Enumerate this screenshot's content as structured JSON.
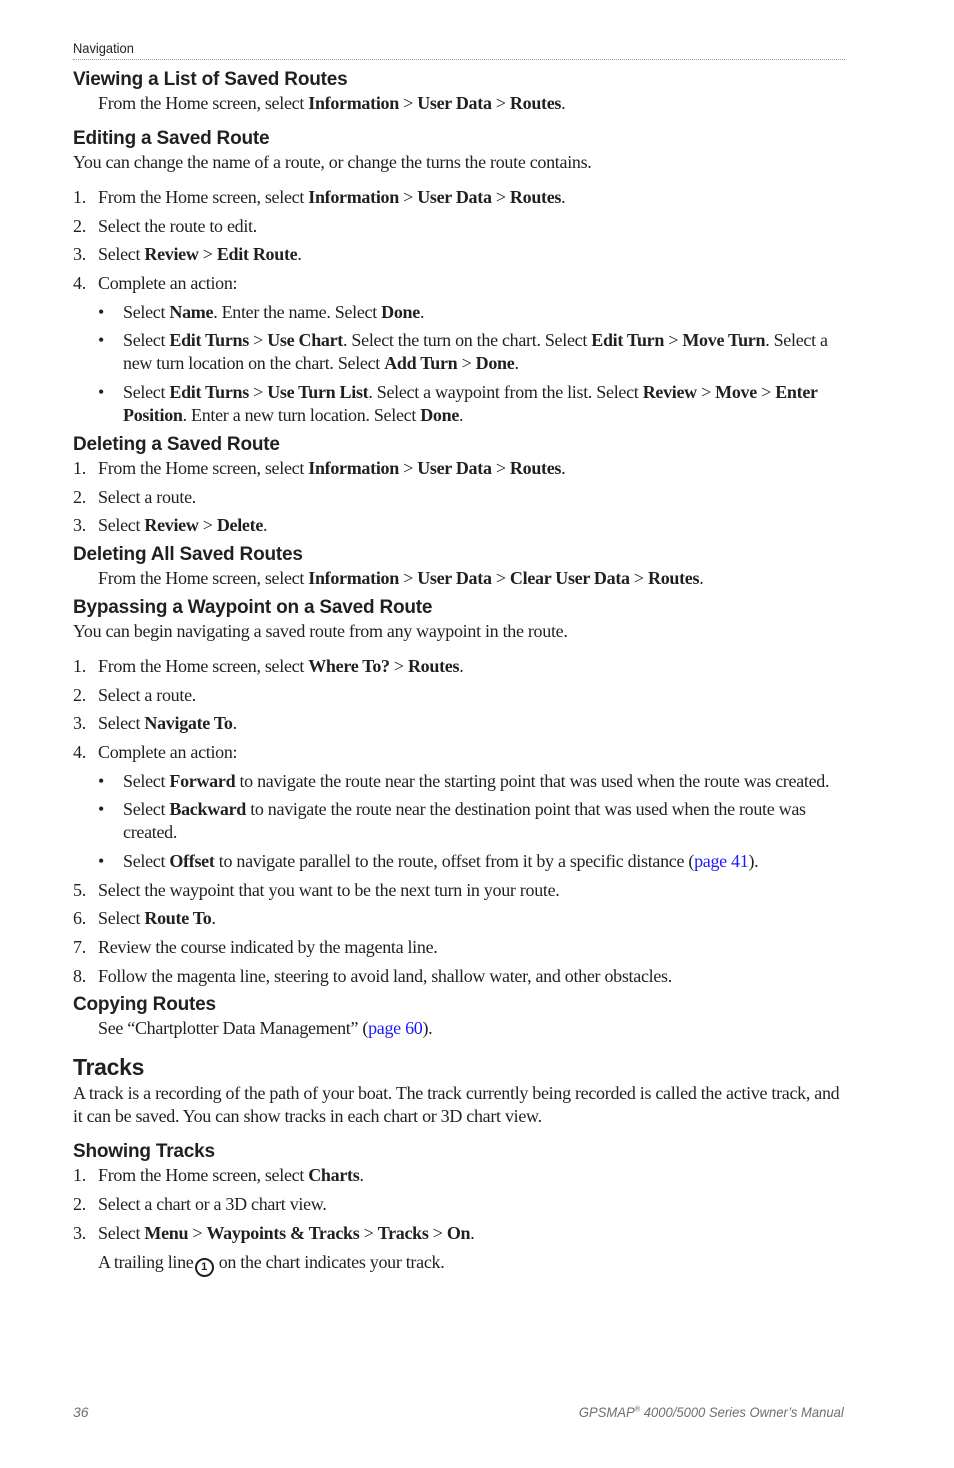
{
  "header": {
    "section": "Navigation"
  },
  "sections": {
    "viewing": {
      "title": "Viewing a List of Saved Routes",
      "text": [
        "From the Home screen, select ",
        "Information",
        " > ",
        "User Data",
        " > ",
        "Routes",
        "."
      ]
    },
    "editing": {
      "title": "Editing a Saved Route",
      "intro": "You can change the name of a route, or change the turns the route contains.",
      "steps": [
        {
          "num": "1.",
          "parts": [
            "From the Home screen, select ",
            "Information",
            " > ",
            "User Data",
            " > ",
            "Routes",
            "."
          ]
        },
        {
          "num": "2.",
          "parts": [
            "Select the route to edit."
          ]
        },
        {
          "num": "3.",
          "parts": [
            "Select ",
            "Review",
            " > ",
            "Edit Route",
            "."
          ]
        },
        {
          "num": "4.",
          "parts": [
            "Complete an action:"
          ]
        }
      ],
      "bullets": [
        {
          "parts": [
            "Select ",
            "Name",
            ". Enter the name. Select ",
            "Done",
            "."
          ]
        },
        {
          "parts": [
            "Select ",
            "Edit Turns",
            " > ",
            "Use Chart",
            ". Select the turn on the chart. Select ",
            "Edit Turn",
            " > ",
            "Move Turn",
            ". Select a new turn location on the chart. Select ",
            "Add Turn",
            " > ",
            "Done",
            "."
          ]
        },
        {
          "parts": [
            "Select ",
            "Edit Turns",
            " > ",
            "Use Turn List",
            ". Select a waypoint from the list. Select ",
            "Review",
            " > ",
            "Move",
            " > ",
            "Enter Position",
            ". Enter a new turn location. Select ",
            "Done",
            "."
          ]
        }
      ]
    },
    "deleting": {
      "title": "Deleting a Saved Route",
      "steps": [
        {
          "num": "1.",
          "parts": [
            "From the Home screen, select ",
            "Information",
            " > ",
            "User Data",
            " > ",
            "Routes",
            "."
          ]
        },
        {
          "num": "2.",
          "parts": [
            "Select a route."
          ]
        },
        {
          "num": "3.",
          "parts": [
            "Select ",
            "Review",
            " > ",
            "Delete",
            "."
          ]
        }
      ]
    },
    "deleting_all": {
      "title": "Deleting All Saved Routes",
      "text": [
        "From the Home screen, select ",
        "Information",
        " > ",
        "User Data",
        " > ",
        "Clear User Data",
        " > ",
        "Routes",
        "."
      ]
    },
    "bypassing": {
      "title": "Bypassing a Waypoint on a Saved Route",
      "intro": "You can begin navigating a saved route from any waypoint in the route.",
      "steps_a": [
        {
          "num": "1.",
          "parts": [
            "From the Home screen, select ",
            "Where To?",
            " > ",
            "Routes",
            "."
          ]
        },
        {
          "num": "2.",
          "parts": [
            "Select a route."
          ]
        },
        {
          "num": "3.",
          "parts": [
            "Select ",
            "Navigate To",
            "."
          ]
        },
        {
          "num": "4.",
          "parts": [
            "Complete an action:"
          ]
        }
      ],
      "bullets": [
        {
          "parts": [
            "Select ",
            "Forward",
            " to navigate the route near the starting point that was used when the route was created."
          ]
        },
        {
          "parts": [
            "Select ",
            "Backward",
            " to navigate the route near the destination point that was used when the route was created."
          ]
        },
        {
          "parts": [
            "Select ",
            "Offset",
            " to navigate parallel to the route, offset from it by a specific distance (",
            "page 41",
            ")."
          ]
        }
      ],
      "steps_b": [
        {
          "num": "5.",
          "parts": [
            "Select the waypoint that you want to be the next turn in your route."
          ]
        },
        {
          "num": "6.",
          "parts": [
            "Select ",
            "Route To",
            "."
          ]
        },
        {
          "num": "7.",
          "parts": [
            "Review the course indicated by the magenta line."
          ]
        },
        {
          "num": "8.",
          "parts": [
            "Follow the magenta line, steering to avoid land, shallow water, and other obstacles."
          ]
        }
      ]
    },
    "copying": {
      "title": "Copying Routes",
      "text": [
        "See “Chartplotter Data Management” (",
        "page 60",
        ")."
      ]
    },
    "tracks": {
      "title": "Tracks",
      "intro": "A track is a recording of the path of your boat. The track currently being recorded is called the active track, and it can be saved. You can show tracks in each chart or 3D chart view."
    },
    "showing": {
      "title": "Showing Tracks",
      "steps": [
        {
          "num": "1.",
          "parts": [
            "From the Home screen, select ",
            "Charts",
            "."
          ]
        },
        {
          "num": "2.",
          "parts": [
            "Select a chart or a 3D chart view."
          ]
        },
        {
          "num": "3.",
          "parts": [
            "Select ",
            "Menu",
            " > ",
            "Waypoints & Tracks",
            " > ",
            "Tracks",
            " > ",
            "On",
            "."
          ]
        }
      ],
      "note_before": "A trailing line",
      "callout": "1",
      "note_after": " on the chart indicates your track."
    }
  },
  "footer": {
    "page_number": "36",
    "manual_title_pre": "GPSMAP",
    "manual_title_reg": "®",
    "manual_title_post": " 4000/5000 Series Owner’s Manual"
  },
  "colors": {
    "text": "#231f20",
    "link": "#1a1aff",
    "footer": "#6d6e71"
  }
}
